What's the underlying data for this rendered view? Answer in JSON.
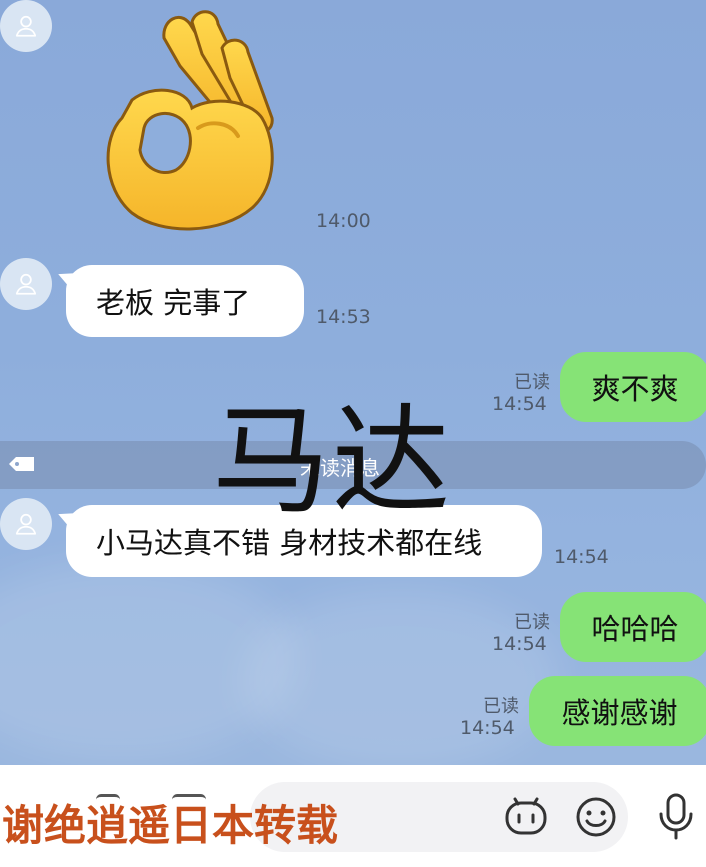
{
  "messages": [
    {
      "type": "sticker",
      "sender": "them",
      "sticker": "ok-hand-emoji",
      "time": "14:00"
    },
    {
      "type": "text",
      "sender": "them",
      "text": "老板 完事了",
      "time": "14:53"
    },
    {
      "type": "text",
      "sender": "me",
      "text": "爽不爽",
      "read": "已读",
      "time": "14:54"
    },
    {
      "type": "text",
      "sender": "them",
      "text": "小马达真不错 身材技术都在线",
      "time": "14:54"
    },
    {
      "type": "text",
      "sender": "me",
      "text": "哈哈哈",
      "read": "已读",
      "time": "14:54"
    },
    {
      "type": "text",
      "sender": "me",
      "text": "感谢感谢",
      "read": "已读",
      "time": "14:54"
    }
  ],
  "unread_divider": {
    "label": "未读消息",
    "icon": "tag-icon"
  },
  "overlay_text": "马达",
  "watermark": "谢绝逍遥日本转载",
  "input_bar": {
    "icons": [
      "robot-icon",
      "emoji-icon",
      "microphone-icon"
    ]
  },
  "colors": {
    "background": "#8eaedc",
    "incoming_bubble": "#ffffff",
    "outgoing_bubble": "#86e376",
    "watermark": "#c8501c"
  }
}
